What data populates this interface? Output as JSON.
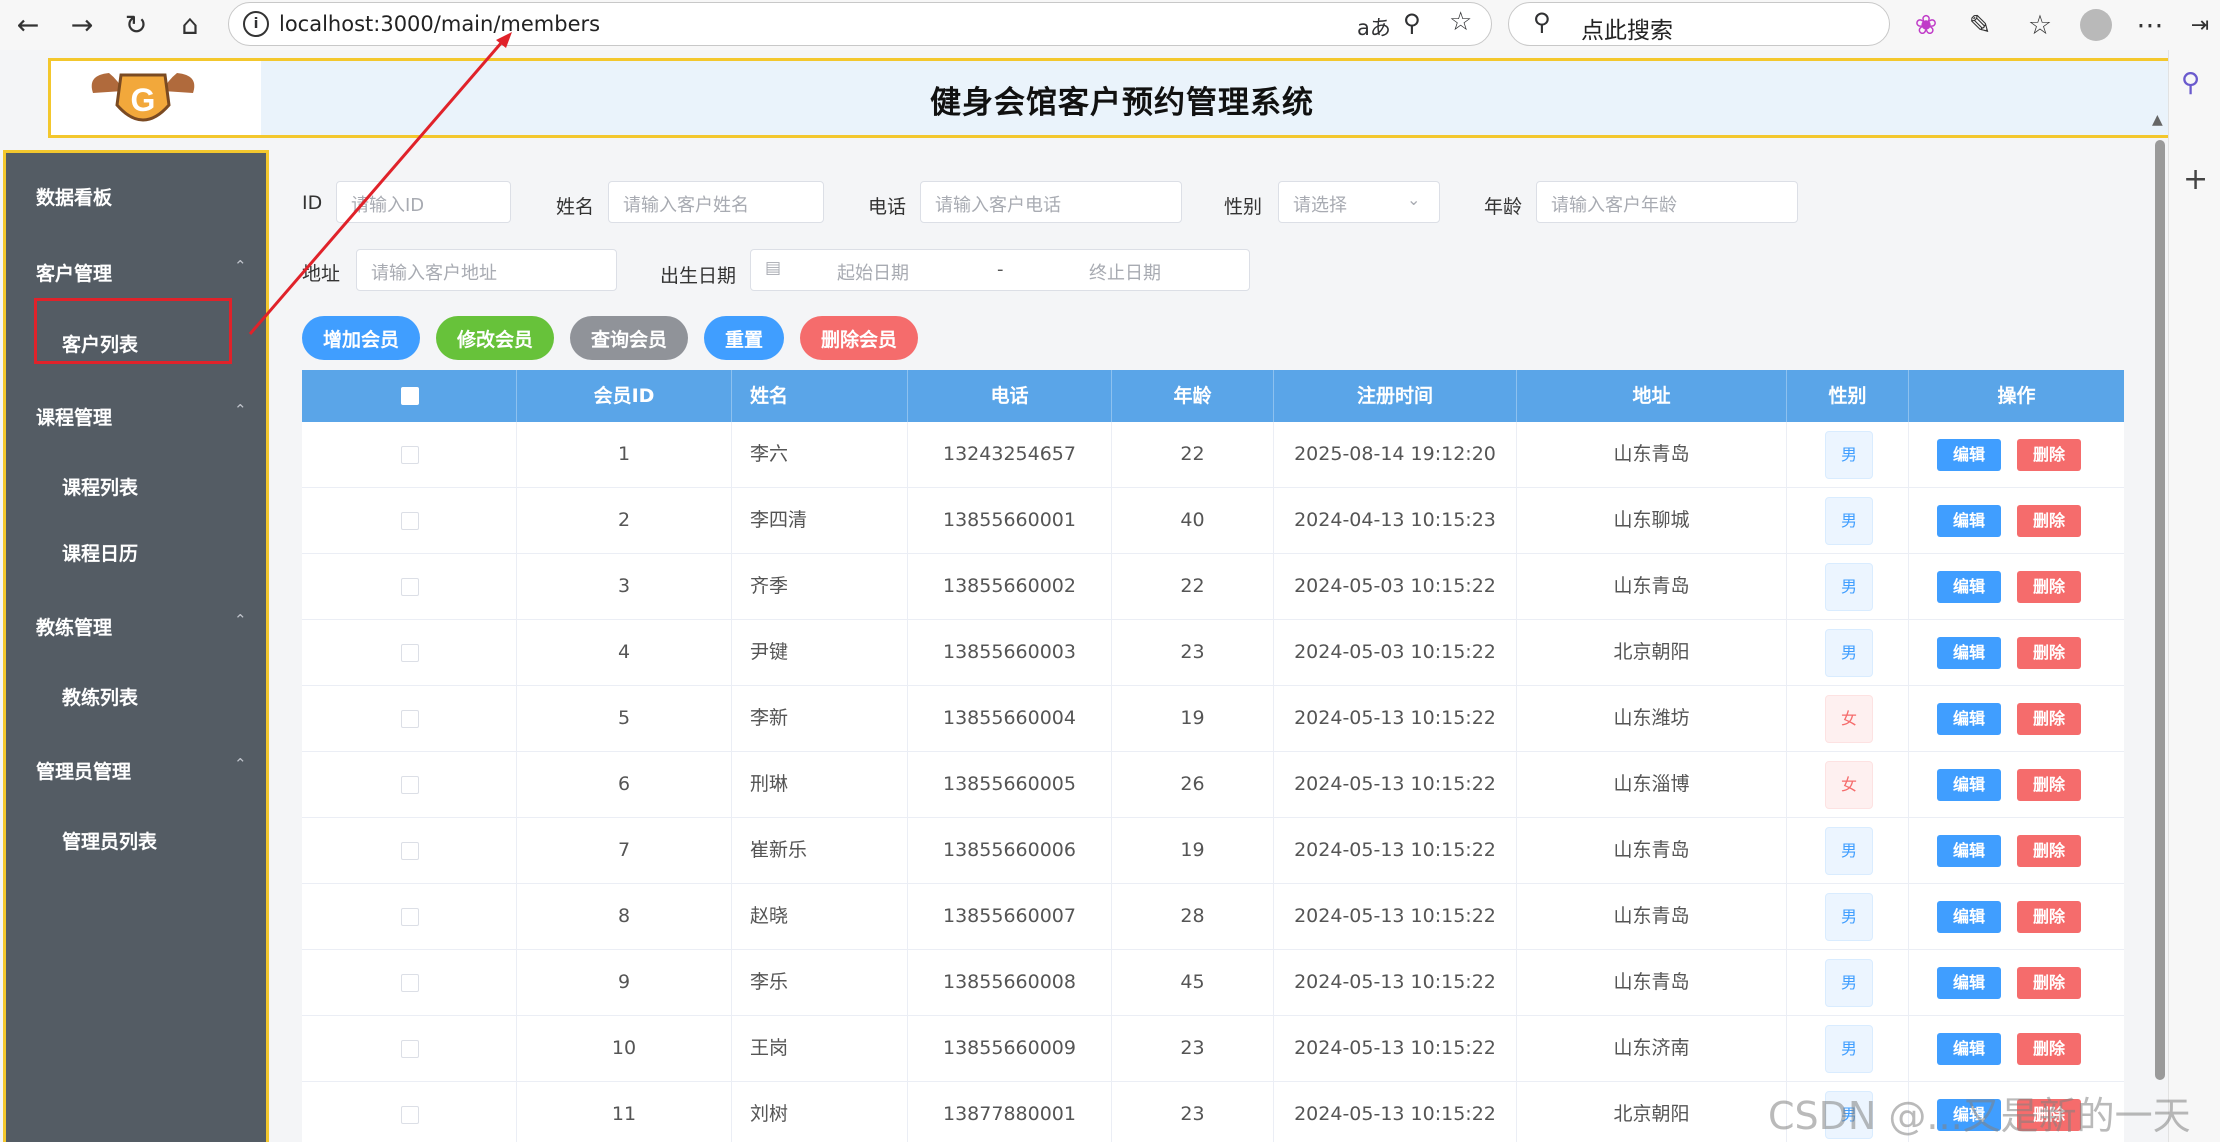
{
  "browser": {
    "url": "localhost:3000/main/members",
    "search_placeholder": "点此搜索",
    "reader_icon_label": "aあ"
  },
  "header": {
    "title": "健身会馆客户预约管理系统",
    "logo_letter": "G"
  },
  "sidebar": {
    "items": [
      {
        "label": "数据看板"
      },
      {
        "label": "客户管理"
      },
      {
        "label": "客户列表"
      },
      {
        "label": "课程管理"
      },
      {
        "label": "课程列表"
      },
      {
        "label": "课程日历"
      },
      {
        "label": "教练管理"
      },
      {
        "label": "教练列表"
      },
      {
        "label": "管理员管理"
      },
      {
        "label": "管理员列表"
      }
    ]
  },
  "filters": {
    "id": {
      "label": "ID",
      "placeholder": "请输入ID"
    },
    "name": {
      "label": "姓名",
      "placeholder": "请输入客户姓名"
    },
    "phone": {
      "label": "电话",
      "placeholder": "请输入客户电话"
    },
    "gender": {
      "label": "性别",
      "placeholder": "请选择"
    },
    "age": {
      "label": "年龄",
      "placeholder": "请输入客户年龄"
    },
    "address": {
      "label": "地址",
      "placeholder": "请输入客户地址"
    },
    "birth": {
      "label": "出生日期",
      "start_placeholder": "起始日期",
      "separator": "-",
      "end_placeholder": "终止日期"
    }
  },
  "actions": {
    "add": "增加会员",
    "edit": "修改会员",
    "query": "查询会员",
    "reset": "重置",
    "delete": "删除会员"
  },
  "table": {
    "headers": [
      "会员ID",
      "姓名",
      "电话",
      "年龄",
      "注册时间",
      "地址",
      "性别",
      "操作"
    ],
    "edit_label": "编辑",
    "delete_label": "删除",
    "rows": [
      {
        "id": "1",
        "name": "李六",
        "phone": "13243254657",
        "age": "22",
        "registered": "2025-08-14 19:12:20",
        "address": "山东青岛",
        "gender": "男"
      },
      {
        "id": "2",
        "name": "李四清",
        "phone": "13855660001",
        "age": "40",
        "registered": "2024-04-13 10:15:23",
        "address": "山东聊城",
        "gender": "男"
      },
      {
        "id": "3",
        "name": "齐季",
        "phone": "13855660002",
        "age": "22",
        "registered": "2024-05-03 10:15:22",
        "address": "山东青岛",
        "gender": "男"
      },
      {
        "id": "4",
        "name": "尹键",
        "phone": "13855660003",
        "age": "23",
        "registered": "2024-05-03 10:15:22",
        "address": "北京朝阳",
        "gender": "男"
      },
      {
        "id": "5",
        "name": "李新",
        "phone": "13855660004",
        "age": "19",
        "registered": "2024-05-13 10:15:22",
        "address": "山东潍坊",
        "gender": "女"
      },
      {
        "id": "6",
        "name": "刑琳",
        "phone": "13855660005",
        "age": "26",
        "registered": "2024-05-13 10:15:22",
        "address": "山东淄博",
        "gender": "女"
      },
      {
        "id": "7",
        "name": "崔新乐",
        "phone": "13855660006",
        "age": "19",
        "registered": "2024-05-13 10:15:22",
        "address": "山东青岛",
        "gender": "男"
      },
      {
        "id": "8",
        "name": "赵晓",
        "phone": "13855660007",
        "age": "28",
        "registered": "2024-05-13 10:15:22",
        "address": "山东青岛",
        "gender": "男"
      },
      {
        "id": "9",
        "name": "李乐",
        "phone": "13855660008",
        "age": "45",
        "registered": "2024-05-13 10:15:22",
        "address": "山东青岛",
        "gender": "男"
      },
      {
        "id": "10",
        "name": "王岗",
        "phone": "13855660009",
        "age": "23",
        "registered": "2024-05-13 10:15:22",
        "address": "山东济南",
        "gender": "男"
      },
      {
        "id": "11",
        "name": "刘树",
        "phone": "13877880001",
        "age": "23",
        "registered": "2024-05-13 10:15:22",
        "address": "北京朝阳",
        "gender": "男"
      }
    ]
  },
  "watermark": "CSDN @...又是新的一天",
  "colors": {
    "primary": "#409eff",
    "success": "#67c23a",
    "info": "#909399",
    "danger": "#f56c6c",
    "sidebar_bg": "#545c64",
    "table_header": "#5aa5e8",
    "highlight_border": "#f3c72d",
    "annotation_red": "#e0222a"
  }
}
